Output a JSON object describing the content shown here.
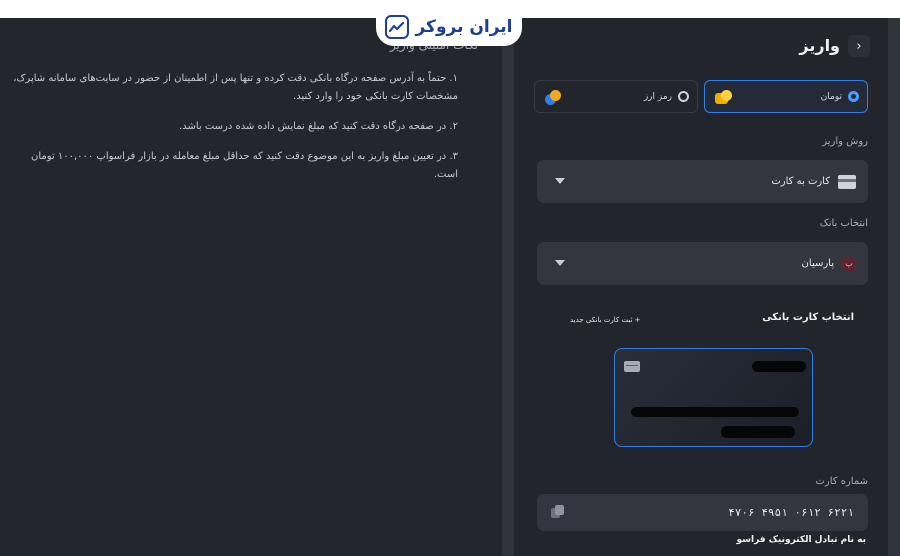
{
  "brand": {
    "name": "ایران بروکر",
    "accent": "#1c3f94"
  },
  "left_panel": {
    "title": "نکات امنیتی واریز",
    "instructions": [
      "۱. حتماً به آدرس صفحه درگاه بانکی دقت کرده و تنها پس از اطمینان از حضور در سایت‌های سامانه شاپرک، مشخصات کارت بانکی خود را وارد کنید.",
      "۲. در صفحه درگاه دقت کنید که مبلغ نمایش داده شده درست باشد.",
      "۳. در تعیین مبلغ واریز به این موضوع دقت کنید که حداقل مبلغ معامله در بازار فراسواپ ۱۰۰,۰۰۰ تومان است."
    ]
  },
  "deposit": {
    "back_glyph": "‹",
    "title": "واریز",
    "currency_tabs": [
      {
        "label": "تومان",
        "active": true,
        "icon": "toman-coins-icon"
      },
      {
        "label": "رمز ارز",
        "active": false,
        "icon": "crypto-coins-icon"
      }
    ],
    "method_label": "روش واریز",
    "method_value": "کارت به کارت",
    "bank_label": "انتخاب بانک",
    "bank_value": "پارسیان",
    "bank_glyph": "پ",
    "cards_header": "انتخاب کارت بانکی",
    "add_card_label": "+ ثبت کارت بانکی جدید",
    "card_number_label": "شماره کارت",
    "card_number": "۶۲۲۱ ۰۶۱۲ ۴۹۵۱ ۴۷۰۶",
    "owner_name": "به نام تبادل الکترونیک فراسو"
  },
  "colors": {
    "accent_blue": "#2f7fe8",
    "panel": "#22252c",
    "field": "#33363e"
  }
}
